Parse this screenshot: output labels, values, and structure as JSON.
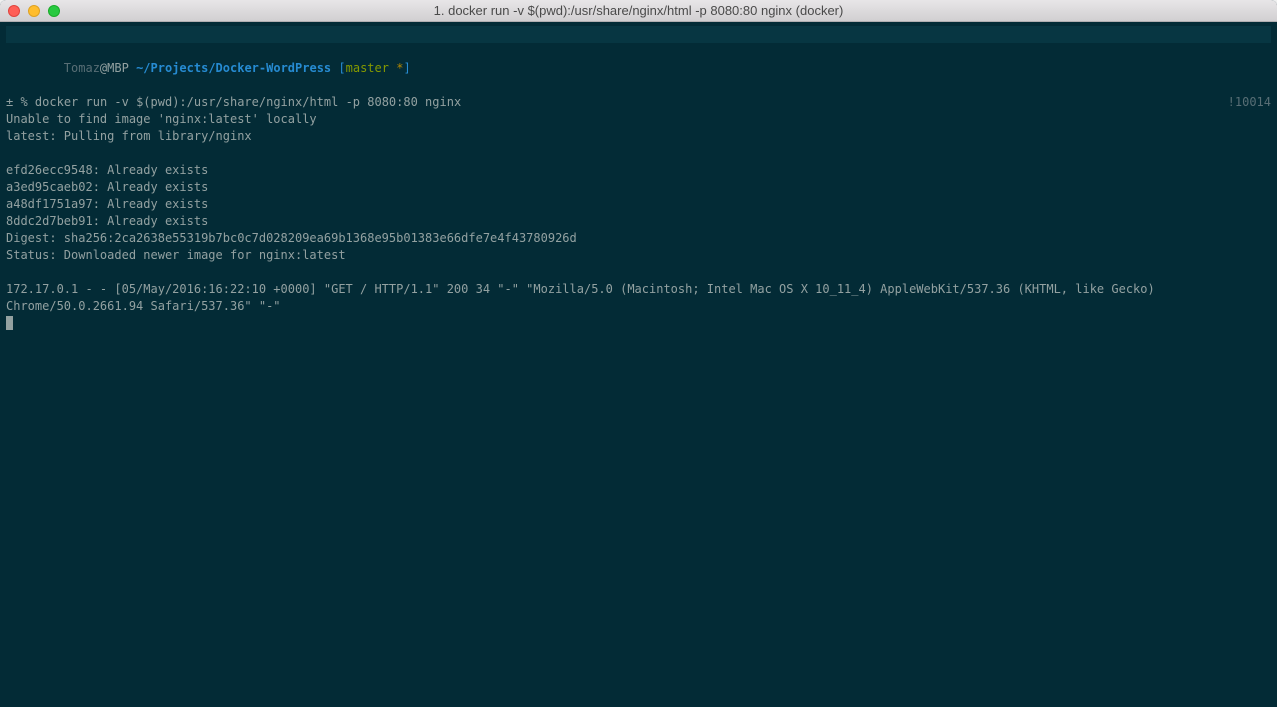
{
  "titlebar": {
    "title": "1. docker run -v $(pwd):/usr/share/nginx/html -p 8080:80 nginx (docker)"
  },
  "prompt": {
    "user": "Tomaz",
    "at": "@",
    "host": "MBP",
    "path": "~/Projects/Docker-WordPress",
    "git_open": "[",
    "git_branch": "master",
    "git_star": " *",
    "git_close": "]"
  },
  "command": {
    "symbol": "± %",
    "text": "docker run -v $(pwd):/usr/share/nginx/html -p 8080:80 nginx",
    "right": "!10014"
  },
  "output": {
    "line1": "Unable to find image 'nginx:latest' locally",
    "line2": "latest: Pulling from library/nginx",
    "layer1": "efd26ecc9548: Already exists",
    "layer2": "a3ed95caeb02: Already exists",
    "layer3": "a48df1751a97: Already exists",
    "layer4": "8ddc2d7beb91: Already exists",
    "digest": "Digest: sha256:2ca2638e55319b7bc0c7d028209ea69b1368e95b01383e66dfe7e4f43780926d",
    "status": "Status: Downloaded newer image for nginx:latest",
    "accesslog": "172.17.0.1 - - [05/May/2016:16:22:10 +0000] \"GET / HTTP/1.1\" 200 34 \"-\" \"Mozilla/5.0 (Macintosh; Intel Mac OS X 10_11_4) AppleWebKit/537.36 (KHTML, like Gecko) Chrome/50.0.2661.94 Safari/537.36\" \"-\""
  }
}
